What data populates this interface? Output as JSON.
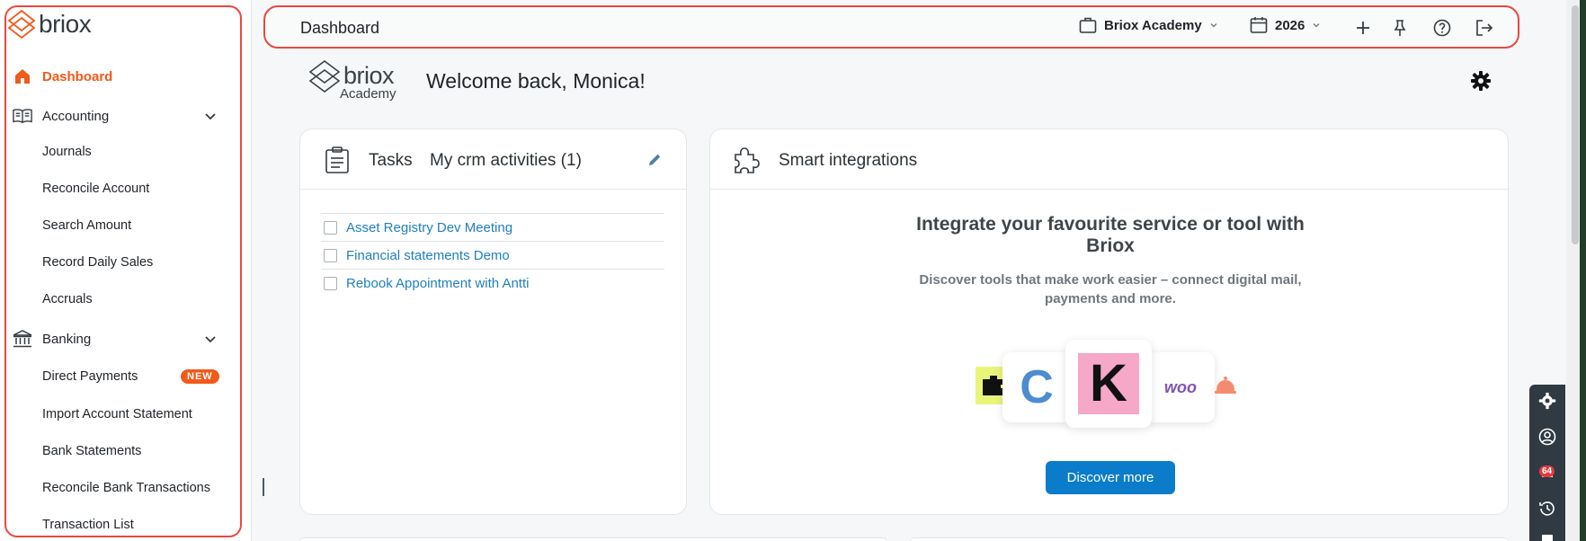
{
  "app": {
    "brand": "briox"
  },
  "sidebar": {
    "items": [
      {
        "label": "Dashboard"
      },
      {
        "label": "Accounting"
      },
      {
        "label": "Journals"
      },
      {
        "label": "Reconcile Account"
      },
      {
        "label": "Search Amount"
      },
      {
        "label": "Record Daily Sales"
      },
      {
        "label": "Accruals"
      },
      {
        "label": "Banking"
      },
      {
        "label": "Direct Payments",
        "badge": "NEW"
      },
      {
        "label": "Import Account Statement"
      },
      {
        "label": "Bank Statements"
      },
      {
        "label": "Reconcile Bank Transactions"
      },
      {
        "label": "Transaction List"
      }
    ]
  },
  "header": {
    "title": "Dashboard",
    "company": "Briox Academy",
    "year": "2026"
  },
  "welcome": {
    "logo_brand": "briox",
    "logo_sub": "Academy",
    "message": "Welcome back, Monica!"
  },
  "tasks": {
    "title": "Tasks",
    "subtitle": "My crm activities (1)",
    "items": [
      "Asset Registry Dev Meeting",
      "Financial statements Demo",
      "Rebook Appointment with Antti"
    ]
  },
  "integrations": {
    "title": "Smart integrations",
    "heading": "Integrate your favourite service or tool with Briox",
    "description": "Discover tools that make work easier – connect digital mail, payments and more.",
    "logos": {
      "c_letter": "C",
      "k_letter": "K",
      "woo": "woo"
    },
    "button": "Discover more"
  },
  "side_tools": {
    "notification_count": "64"
  },
  "colors": {
    "accent": "#f05a1a",
    "link": "#1f7fbf",
    "primary_button": "#0b7cc9",
    "highlight_outline": "#e8483f"
  }
}
